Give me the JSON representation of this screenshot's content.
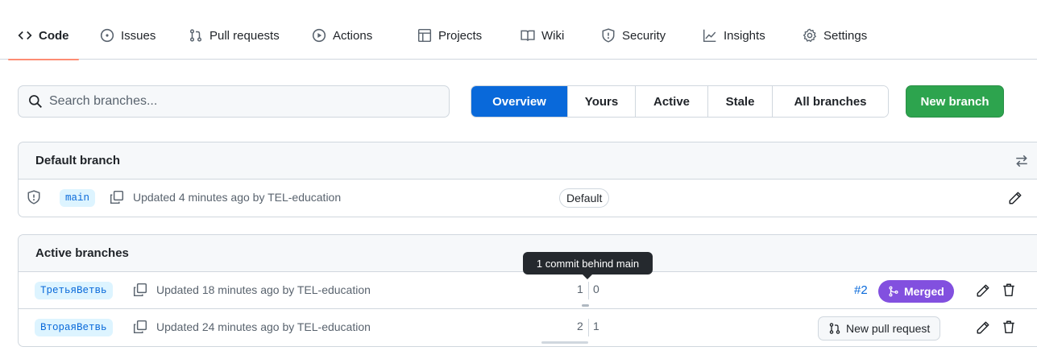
{
  "nav": {
    "items": [
      {
        "label": "Code",
        "icon": "code-icon",
        "selected": true
      },
      {
        "label": "Issues",
        "icon": "issue-opened-icon"
      },
      {
        "label": "Pull requests",
        "icon": "git-pull-request-icon"
      },
      {
        "label": "Actions",
        "icon": "play-icon"
      },
      {
        "label": "Projects",
        "icon": "table-icon"
      },
      {
        "label": "Wiki",
        "icon": "book-icon"
      },
      {
        "label": "Security",
        "icon": "shield-icon"
      },
      {
        "label": "Insights",
        "icon": "graph-icon"
      },
      {
        "label": "Settings",
        "icon": "gear-icon"
      }
    ]
  },
  "search": {
    "placeholder": "Search branches..."
  },
  "filters": {
    "tabs": [
      "Overview",
      "Yours",
      "Active",
      "Stale",
      "All branches"
    ],
    "active": "Overview"
  },
  "new_branch_label": "New branch",
  "default_section": {
    "title": "Default branch",
    "branch": {
      "name": "main",
      "updated": "Updated 4 minutes ago by TEL-education",
      "badge": "Default"
    }
  },
  "active_section": {
    "title": "Active branches",
    "branches": [
      {
        "name": "ТретьяВетвь",
        "updated": "Updated 18 minutes ago by TEL-education",
        "behind": "1",
        "ahead": "0",
        "pr_number": "#2",
        "pr_status": "Merged"
      },
      {
        "name": "ВтораяВетвь",
        "updated": "Updated 24 minutes ago by TEL-education",
        "behind": "2",
        "ahead": "1",
        "action": "New pull request"
      }
    ]
  },
  "tooltip": "1 commit behind main",
  "colors": {
    "accent": "#0969da",
    "merged": "#8250df",
    "primary_green": "#2da44e",
    "nav_underline": "#fd8c73"
  }
}
